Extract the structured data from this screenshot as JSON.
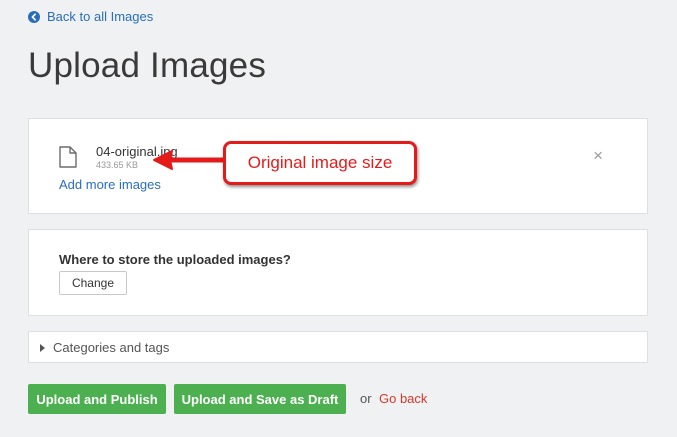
{
  "nav": {
    "back_label": "Back to all Images"
  },
  "page": {
    "title": "Upload Images"
  },
  "upload": {
    "file_name": "04-original.jpg",
    "file_size": "433.65 KB",
    "add_more_label": "Add more images",
    "remove_symbol": "×"
  },
  "annotation": {
    "callout_text": "Original image size",
    "color": "#e31b1b"
  },
  "storage": {
    "question": "Where to store the uploaded images?",
    "change_label": "Change"
  },
  "categories": {
    "toggle_label": "Categories and tags"
  },
  "actions": {
    "publish_label": "Upload and Publish",
    "draft_label": "Upload and Save as Draft",
    "or_text": "or",
    "go_back_label": "Go back"
  },
  "colors": {
    "link": "#2a6ebb",
    "primary_button": "#4caf50",
    "danger_link": "#d9372b",
    "background": "#f0f1f3"
  },
  "icons": {
    "back": "arrow-circle-left-icon",
    "file": "file-icon",
    "remove": "close-icon",
    "toggle": "caret-right-icon",
    "annotation": "arrow-left-icon"
  }
}
